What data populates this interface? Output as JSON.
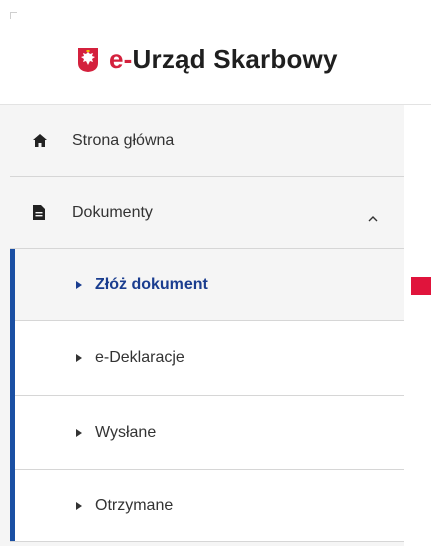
{
  "header": {
    "title_prefix": "e-",
    "title_main": "Urząd Skarbowy",
    "emblem_icon": "polish-eagle-icon"
  },
  "sidebar": {
    "items": [
      {
        "label": "Strona główna",
        "icon": "home-icon"
      },
      {
        "label": "Dokumenty",
        "icon": "document-icon",
        "expanded": true,
        "chevron": "chevron-up-icon"
      }
    ],
    "subitems": [
      {
        "label": "Złóż dokument",
        "active": true
      },
      {
        "label": "e-Deklaracje",
        "active": false
      },
      {
        "label": "Wysłane",
        "active": false
      },
      {
        "label": "Otrzymane",
        "active": false
      }
    ]
  },
  "colors": {
    "accent_red": "#d4213d",
    "active_blue": "#1a3d8f",
    "sidebar_bg": "#f5f5f5"
  }
}
